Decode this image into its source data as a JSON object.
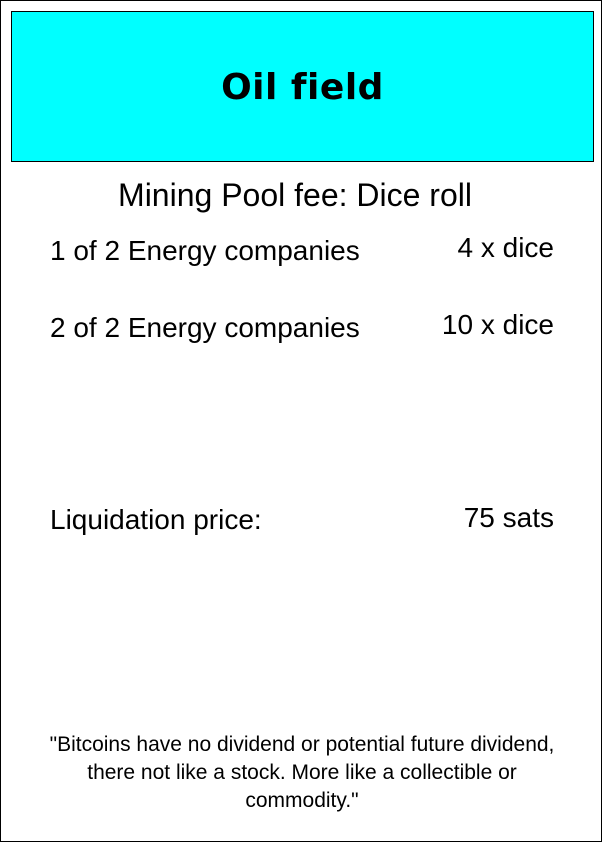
{
  "card": {
    "title": "Oil field",
    "header_color": "#00ffff",
    "fee_title": "Mining Pool fee: Dice roll",
    "fee_rows": [
      {
        "label": "1 of 2 Energy companies",
        "value": "4 x dice"
      },
      {
        "label": "2 of 2 Energy companies",
        "value": "10 x dice"
      }
    ],
    "liquidation": {
      "label": "Liquidation price:",
      "value": "75 sats"
    },
    "quote": "\"Bitcoins have no dividend or potential future dividend, there not like a stock. More like a collectible or commodity.\""
  }
}
